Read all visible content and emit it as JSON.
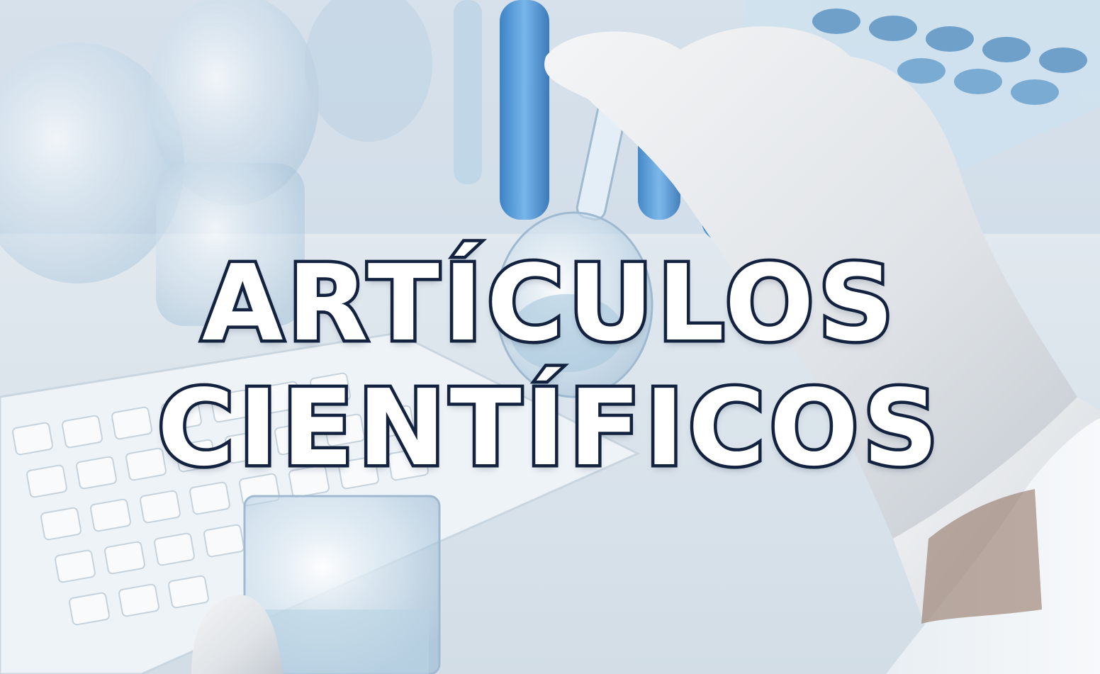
{
  "banner": {
    "title_line_1": "ARTÍCULOS",
    "title_line_2": "CIENTÍFICOS"
  },
  "colors": {
    "title_fill": "#ffffff",
    "title_outline": "#14233f",
    "background_tint": "#dfe9f0",
    "liquid_blue": "#3f8fd6"
  },
  "scene": {
    "subjects": [
      "gloved-hand-holding-flask",
      "test-tubes-rack",
      "beakers",
      "keyboard",
      "glass-beaker"
    ]
  }
}
